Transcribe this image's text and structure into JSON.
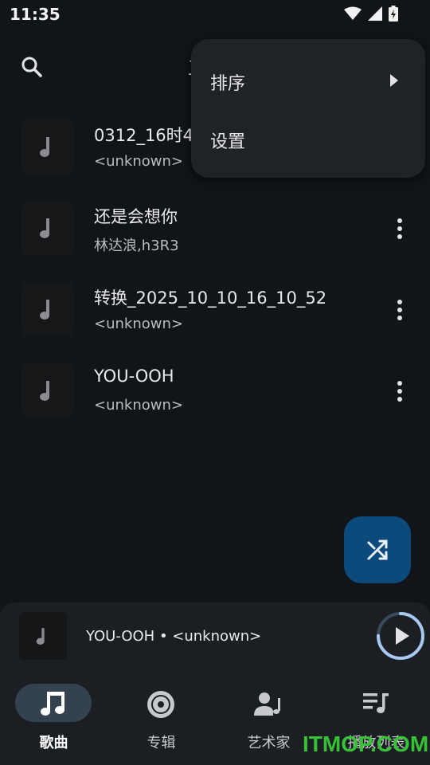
{
  "status_bar": {
    "time": "11:35"
  },
  "top_bar": {
    "title_partial": "卫"
  },
  "songs": [
    {
      "title": "0312_16时4",
      "artist": "<unknown>"
    },
    {
      "title": "还是会想你",
      "artist": "林达浪,h3R3"
    },
    {
      "title": "转换_2025_10_10_16_10_52",
      "artist": "<unknown>"
    },
    {
      "title": "YOU-OOH",
      "artist": "<unknown>"
    }
  ],
  "menu": {
    "items": [
      {
        "label": "排序",
        "has_submenu": true
      },
      {
        "label": "设置",
        "has_submenu": false
      }
    ]
  },
  "mini_player": {
    "now_playing": "YOU-OOH • <unknown>",
    "progress": 0.75
  },
  "bottom_nav": {
    "items": [
      {
        "label": "歌曲",
        "icon": "music-note-icon",
        "active": true
      },
      {
        "label": "专辑",
        "icon": "disc-icon",
        "active": false
      },
      {
        "label": "艺术家",
        "icon": "artist-icon",
        "active": false
      },
      {
        "label": "播放列表",
        "icon": "playlist-icon",
        "active": false
      }
    ]
  },
  "watermark": {
    "text": "ITMOP.COM"
  },
  "colors": {
    "background": "#111418",
    "accent": "#a8c8f0",
    "fab": "#0d4a7c",
    "nav_pill": "#34414f"
  }
}
